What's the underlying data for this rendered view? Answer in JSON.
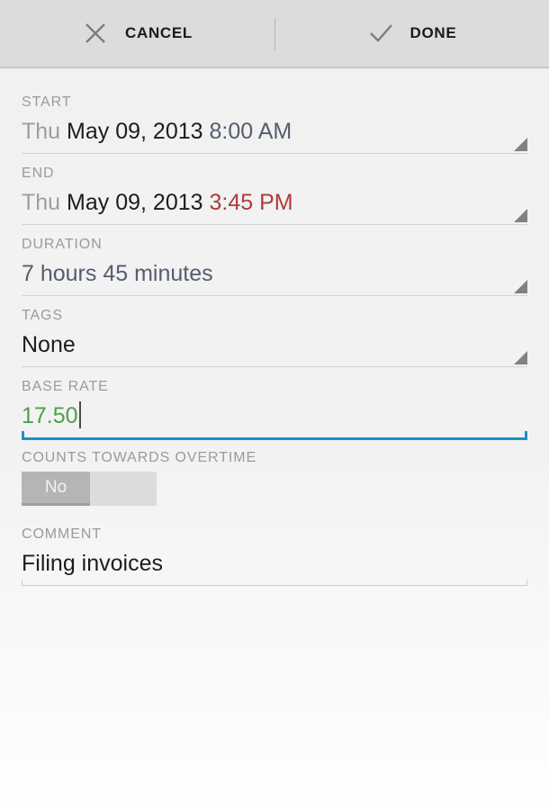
{
  "actionbar": {
    "cancel": {
      "label": "CANCEL",
      "icon": "close-icon"
    },
    "done": {
      "label": "DONE",
      "icon": "check-icon"
    },
    "icon_color": "#7d7d7d",
    "background": "#dcdcdc"
  },
  "form": {
    "start": {
      "label": "START",
      "weekday": "Thu",
      "date": "May 09, 2013",
      "time": "8:00 AM",
      "time_color": "#555d70"
    },
    "end": {
      "label": "END",
      "weekday": "Thu",
      "date": "May 09, 2013",
      "time": "3:45 PM",
      "time_color": "#b03b3b"
    },
    "duration": {
      "label": "DURATION",
      "value": "7 hours 45 minutes",
      "value_color": "#555d70"
    },
    "tags": {
      "label": "TAGS",
      "value": "None"
    },
    "base_rate": {
      "label": "BASE RATE",
      "value": "17.50",
      "value_color": "#4ba04b",
      "focused": true,
      "focus_color": "#1f90c0"
    },
    "overtime": {
      "label": "COUNTS TOWARDS OVERTIME",
      "state_label": "No",
      "checked": false
    },
    "comment": {
      "label": "COMMENT",
      "value": "Filing invoices"
    }
  }
}
